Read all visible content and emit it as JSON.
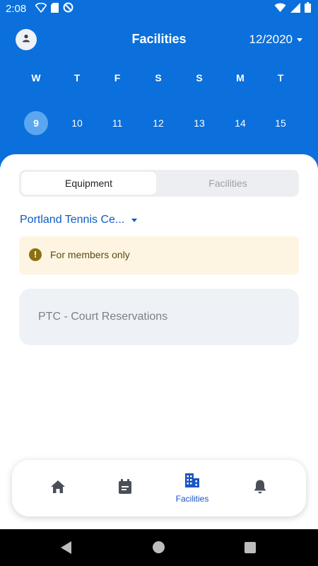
{
  "status_bar": {
    "time": "2:08",
    "left_icons": [
      "wifi-question-icon",
      "sd-card-icon",
      "do-not-disturb-icon"
    ],
    "right_icons": [
      "wifi-icon",
      "signal-icon",
      "battery-icon"
    ]
  },
  "header": {
    "title": "Facilities",
    "month": "12/2020",
    "avatar_icon": "person-icon"
  },
  "week": {
    "days": [
      {
        "letter": "W",
        "date": "9",
        "selected": true
      },
      {
        "letter": "T",
        "date": "10",
        "selected": false
      },
      {
        "letter": "F",
        "date": "11",
        "selected": false
      },
      {
        "letter": "S",
        "date": "12",
        "selected": false
      },
      {
        "letter": "S",
        "date": "13",
        "selected": false
      },
      {
        "letter": "M",
        "date": "14",
        "selected": false
      },
      {
        "letter": "T",
        "date": "15",
        "selected": false
      }
    ]
  },
  "tabs": {
    "active": "Equipment",
    "inactive": "Facilities"
  },
  "location": {
    "name": "Portland Tennis Ce..."
  },
  "notice": {
    "icon": "exclamation-icon",
    "text": "For members only"
  },
  "facilities": [
    {
      "name": "PTC - Court Reservations"
    }
  ],
  "bottom_nav": {
    "items": [
      {
        "icon": "home-icon",
        "label": "",
        "active": false
      },
      {
        "icon": "calendar-icon",
        "label": "",
        "active": false
      },
      {
        "icon": "building-icon",
        "label": "Facilities",
        "active": true
      },
      {
        "icon": "bell-icon",
        "label": "",
        "active": false
      }
    ]
  },
  "colors": {
    "brand_blue": "#0b6fdc",
    "selected_day": "#5aa7ef",
    "link_blue": "#0d5bc7",
    "notice_bg": "#fdf5e1"
  }
}
